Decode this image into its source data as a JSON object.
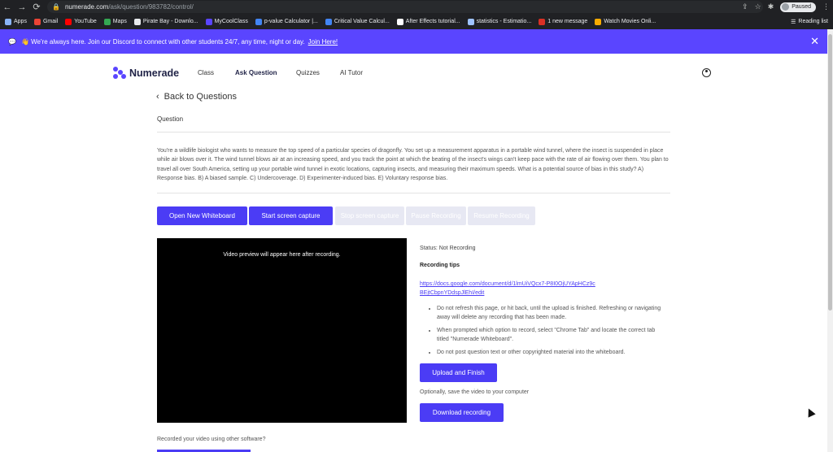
{
  "browser": {
    "url_host": "numerade.com",
    "url_path": "/ask/question/983782/control/",
    "profile_label": "Paused",
    "bookmarks": [
      {
        "label": "Apps",
        "color": "#8ab4f8"
      },
      {
        "label": "Gmail",
        "color": "#ea4335"
      },
      {
        "label": "YouTube",
        "color": "#ff0000"
      },
      {
        "label": "Maps",
        "color": "#34a853"
      },
      {
        "label": "Pirate Bay - Downlo...",
        "color": "#e8eaed"
      },
      {
        "label": "MyCoolClass",
        "color": "#5a45ff"
      },
      {
        "label": "p-value Calculator |...",
        "color": "#4285f4"
      },
      {
        "label": "Critical Value Calcul...",
        "color": "#4285f4"
      },
      {
        "label": "After Effects tutorial...",
        "color": "#ffffff"
      },
      {
        "label": "statistics - Estimatio...",
        "color": "#9fc3ff"
      },
      {
        "label": "1 new message",
        "color": "#d93025"
      },
      {
        "label": "Watch Movies Onli...",
        "color": "#f9ab00"
      }
    ],
    "reading_list": "Reading list"
  },
  "banner": {
    "text": "👋 We're always here. Join our Discord to connect with other students 24/7, any time, night or day.",
    "link": "Join Here!"
  },
  "nav": {
    "logo": "Numerade",
    "items": [
      "Class",
      "Ask Question",
      "Quizzes",
      "AI Tutor"
    ],
    "active": "Ask Question"
  },
  "page": {
    "back_label": "Back to Questions",
    "section_label": "Question",
    "question": "You're a wildlife biologist who wants to measure the top speed of a particular species of dragonfly. You set up a measurement apparatus in a portable wind tunnel, where the insect is suspended in place while air blows over it. The wind tunnel blows air at an increasing speed, and you track the point at which the beating of the insect's wings can't keep pace with the rate of air flowing over them. You plan to travel all over South America, setting up your portable wind tunnel in exotic locations, capturing insects, and measuring their maximum speeds. What is a potential source of bias in this study? A) Response bias. B) A biased sample. C) Undercoverage. D) Experimenter-induced bias. E) Voluntary response bias."
  },
  "controls": {
    "open_whiteboard": "Open New Whiteboard",
    "start_capture": "Start screen capture",
    "stop_capture": "Stop screen capture",
    "pause": "Pause Recording",
    "resume": "Resume Recording"
  },
  "video": {
    "placeholder": "Video preview will appear here after recording."
  },
  "side": {
    "status": "Status: Not Recording",
    "tips_heading": "Recording tips",
    "tips_link": "https://docs.google.com/document/d/1lmUiVQcx7-P8I0OjUYApHCz9cBEjtCbpnYDdspJlEhI/edit",
    "tips": [
      "Do not refresh this page, or hit back, until the upload is finished. Refreshing or navigating away will delete any recording that has been made.",
      "When prompted which option to record, select \"Chrome Tab\" and locate the correct tab titled \"Numerade Whiteboard\".",
      "Do not post question text or other copyrighted material into the whiteboard."
    ],
    "upload_button": "Upload and Finish",
    "optional_text": "Optionally, save the video to your computer",
    "download_button": "Download recording"
  },
  "footer": {
    "recorded_other": "Recorded your video using other software?"
  }
}
